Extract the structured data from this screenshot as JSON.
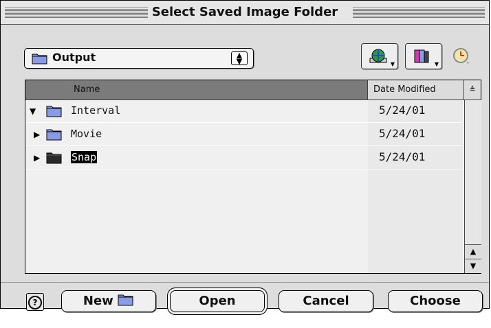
{
  "window": {
    "title": "Select Saved Image Folder"
  },
  "location": {
    "folder_label": "Output"
  },
  "toolbar": {
    "buttons": [
      {
        "name": "shortcuts",
        "icon": "globe-icon"
      },
      {
        "name": "favorites",
        "icon": "books-icon"
      },
      {
        "name": "recent",
        "icon": "clock-icon"
      }
    ]
  },
  "list": {
    "columns": [
      "Name",
      "Date Modified"
    ],
    "rows": [
      {
        "name": "Interval",
        "date": "5/24/01",
        "expanded": true,
        "selected": false
      },
      {
        "name": "Movie",
        "date": "5/24/01",
        "expanded": false,
        "selected": false
      },
      {
        "name": "Snap",
        "date": "5/24/01",
        "expanded": false,
        "selected": true
      }
    ]
  },
  "buttons": {
    "new_label": "New",
    "open_label": "Open",
    "cancel_label": "Cancel",
    "choose_label": "Choose"
  },
  "colors": {
    "header_active": "#7b7b7b",
    "folder_blue": "#7f8fe0",
    "selection": "#000000"
  }
}
